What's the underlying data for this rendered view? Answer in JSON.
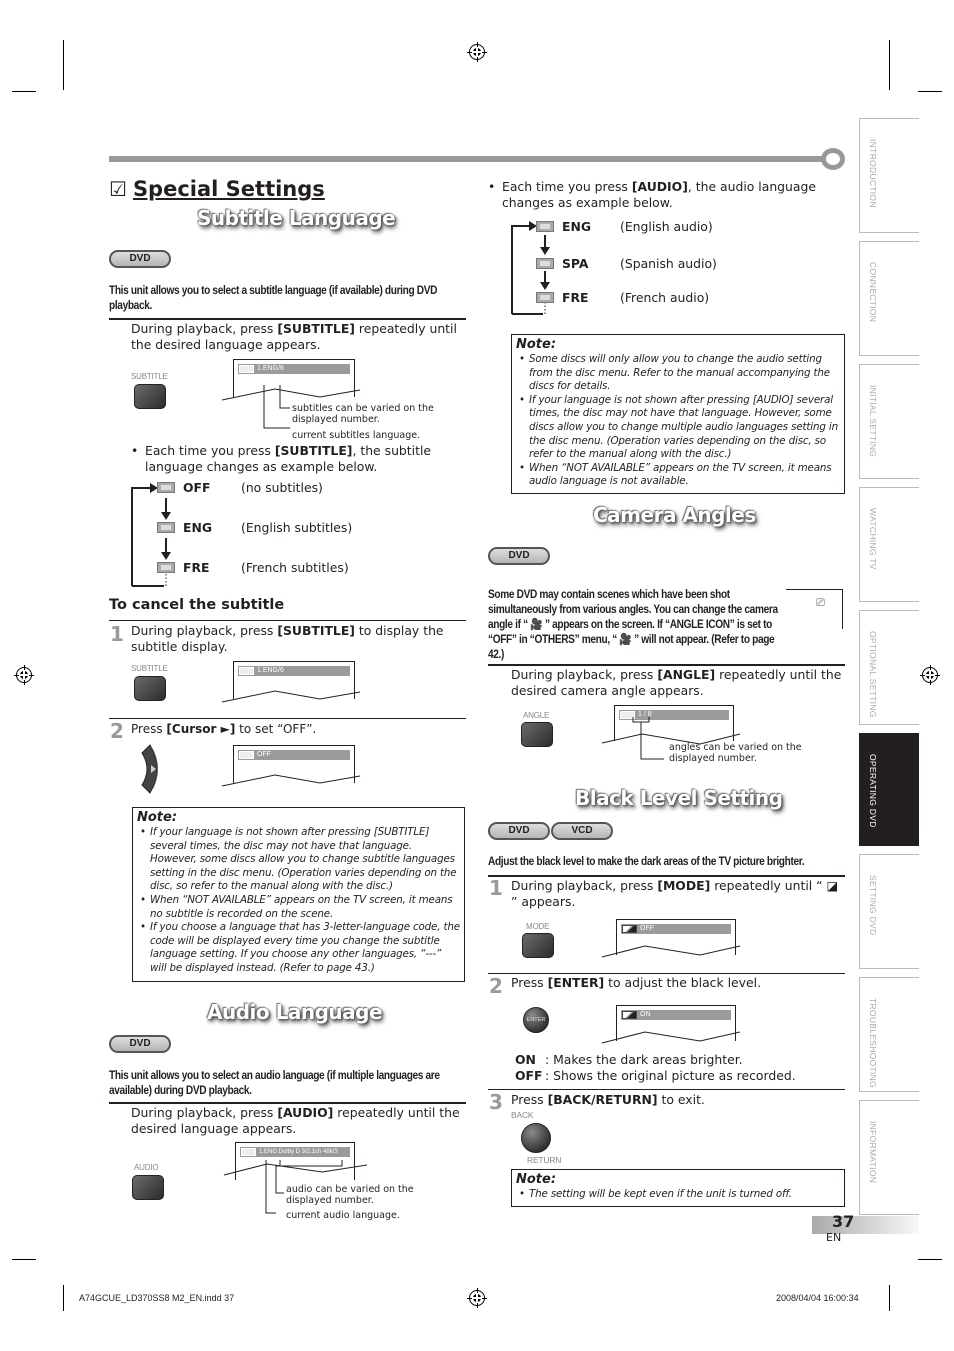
{
  "page": {
    "title": "Special Settings",
    "checkbox_glyph": "☑",
    "page_number": "37",
    "language": "EN",
    "footer_left": "A74GCUE_LD370SS8 M2_EN.indd   37",
    "footer_right": "2008/04/04   16:00:34"
  },
  "side_tabs": [
    {
      "label": "INTRODUCTION",
      "active": false
    },
    {
      "label": "CONNECTION",
      "active": false
    },
    {
      "label": "INITIAL  SETTING",
      "active": false
    },
    {
      "label": "WATCHING  TV",
      "active": false
    },
    {
      "label": "OPTIONAL  SETTING",
      "active": false
    },
    {
      "label": "OPERATING  DVD",
      "active": true
    },
    {
      "label": "SETTING  DVD",
      "active": false
    },
    {
      "label": "TROUBLESHOOTING",
      "active": false
    },
    {
      "label": "INFORMATION",
      "active": false
    }
  ],
  "subtitle": {
    "title": "Subtitle Language",
    "badge": "DVD",
    "intro": "This unit allows you to select a subtitle language (if available) during DVD playback.",
    "step_pre": "During playback, press ",
    "step_key": "[SUBTITLE]",
    "step_post": " repeatedly until the desired language appears.",
    "button_label": "SUBTITLE",
    "osd_text": "1.ENG/6",
    "callout_1": "subtitles can be varied on the displayed number.",
    "callout_2": "current subtitles language.",
    "bullet_pre": "Each time you press ",
    "bullet_key": "[SUBTITLE]",
    "bullet_post": ", the subtitle language changes as example below.",
    "cycle": [
      {
        "code": "OFF",
        "desc": "(no subtitles)"
      },
      {
        "code": "ENG",
        "desc": "(English subtitles)"
      },
      {
        "code": "FRE",
        "desc": "(French subtitles)"
      }
    ],
    "cancel_heading": "To cancel the subtitle",
    "cancel_steps": [
      {
        "num": "1",
        "pre": "During playback, press ",
        "key": "[SUBTITLE]",
        "post": " to display the subtitle display.",
        "button_label": "SUBTITLE",
        "osd_text": "1.ENG/6"
      },
      {
        "num": "2",
        "pre": "Press ",
        "key": "[Cursor ►]",
        "post": " to set “OFF”.",
        "osd_text": "OFF"
      }
    ],
    "note_title": "Note:",
    "notes": [
      "If your language is not shown after pressing [SUBTITLE] several times, the disc may not have that language. However, some discs allow you to change subtitle languages setting in the disc menu. (Operation varies depending on the disc, so refer to the manual along with the disc.)",
      "When “NOT AVAILABLE” appears on the TV screen, it means no subtitle is recorded on the scene.",
      "If you choose a language that has 3-letter-language code, the code will be displayed every time you change the subtitle language setting. If you choose any other languages, “---” will be displayed instead. (Refer to page 43.)"
    ]
  },
  "audio": {
    "title": "Audio Language",
    "badge": "DVD",
    "intro": "This unit allows you to select an audio language (if multiple languages are available) during DVD playback.",
    "step_pre": "During playback, press ",
    "step_key": "[AUDIO]",
    "step_post": " repeatedly until the desired language appears.",
    "button_label": "AUDIO",
    "osd_text": "1.ENG Dolby D 3/2.1ch  48k/3",
    "callout_1": "audio can be varied on the displayed number.",
    "callout_2": "current audio language.",
    "bullet_pre": "Each time you press ",
    "bullet_key": "[AUDIO]",
    "bullet_post": ", the audio language changes as example below.",
    "cycle": [
      {
        "code": "ENG",
        "desc": "(English audio)"
      },
      {
        "code": "SPA",
        "desc": "(Spanish audio)"
      },
      {
        "code": "FRE",
        "desc": "(French audio)"
      }
    ],
    "note_title": "Note:",
    "notes": [
      "Some discs will only allow you to change the audio setting from the disc menu. Refer to the manual accompanying the discs for details.",
      "If your language is not shown after pressing [AUDIO] several times, the disc may not have that language. However, some discs allow you to change multiple audio languages setting in the disc menu. (Operation varies depending on the disc, so refer to the manual along with the disc.)",
      "When “NOT AVAILABLE” appears on the TV screen, it means audio language is not available."
    ]
  },
  "camera": {
    "title": "Camera Angles",
    "badge": "DVD",
    "intro": "Some DVD may contain scenes which have been shot simultaneously from various angles. You can change the camera angle if “ 🎥 ” appears on the screen. If “ANGLE ICON” is set to “OFF” in “OTHERS” menu, “ 🎥 ” will not appear. (Refer to page 42.)",
    "step_pre": "During playback, press ",
    "step_key": "[ANGLE]",
    "step_post": " repeatedly until the desired camera angle appears.",
    "button_label": "ANGLE",
    "osd_text": "1 / 8",
    "callout_1": "angles can be varied on the displayed number."
  },
  "black_level": {
    "title": "Black Level Setting",
    "badges": [
      "DVD",
      "VCD"
    ],
    "intro": "Adjust the black level to make the dark areas of the TV picture brighter.",
    "steps": [
      {
        "num": "1",
        "pre": "During playback, press ",
        "key": "[MODE]",
        "post": " repeatedly until “ ◪ ” appears.",
        "button_label": "MODE",
        "osd_text": "OFF"
      },
      {
        "num": "2",
        "pre": "Press ",
        "key": "[ENTER]",
        "post": " to adjust the black level.",
        "button_label": "ENTER",
        "osd_text": "ON"
      },
      {
        "num": "3",
        "pre": "Press ",
        "key": "[BACK/RETURN]",
        "post": " to exit.",
        "button_label_top": "BACK",
        "button_label_bottom": "RETURN"
      }
    ],
    "options": [
      {
        "key": "ON",
        "desc": ":  Makes the dark areas brighter."
      },
      {
        "key": "OFF",
        "desc": ":  Shows the original picture as recorded."
      }
    ],
    "note_title": "Note:",
    "notes": [
      "The setting will be kept even if the unit is turned off."
    ]
  }
}
